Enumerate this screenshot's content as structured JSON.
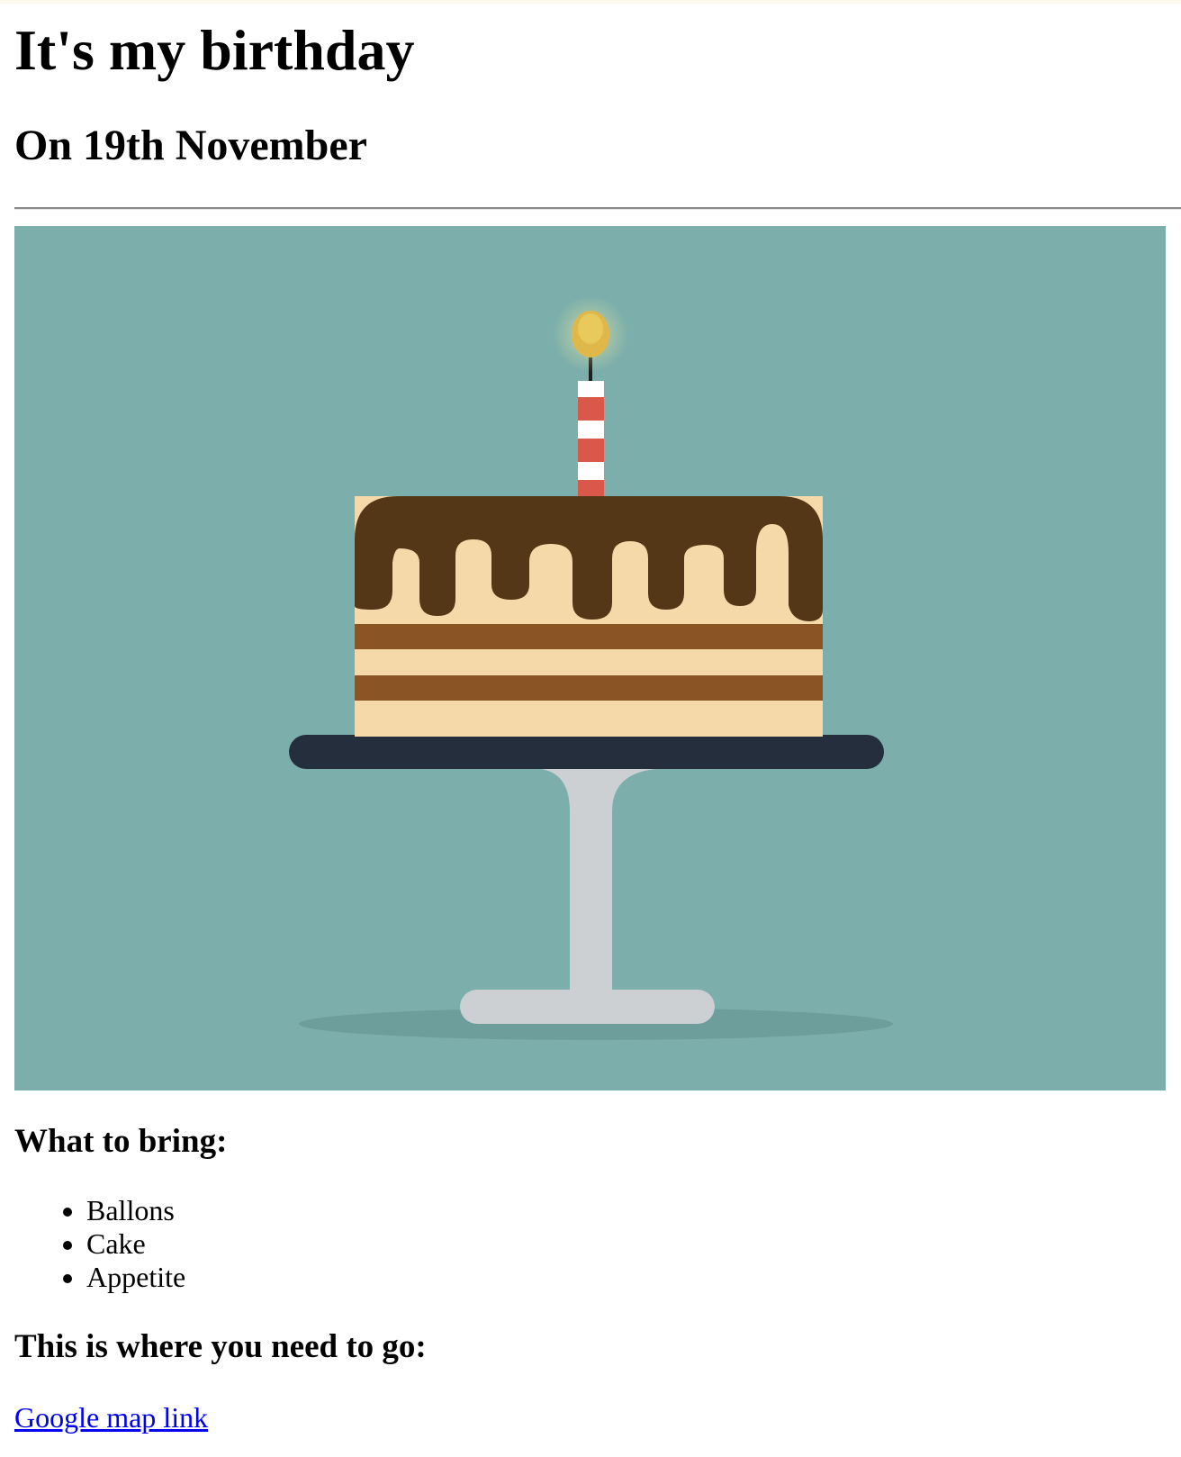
{
  "page": {
    "title": "It's my birthday",
    "subtitle": "On 19th November"
  },
  "hero_image": {
    "icon": "birthday-cake-illustration",
    "background_color": "#7cafab"
  },
  "bring_section": {
    "heading": "What to bring:",
    "items": [
      "Ballons",
      "Cake",
      "Appetite"
    ]
  },
  "location_section": {
    "heading": "This is where you need to go:",
    "link_text": "Google map link",
    "link_color": "#0000ee"
  }
}
